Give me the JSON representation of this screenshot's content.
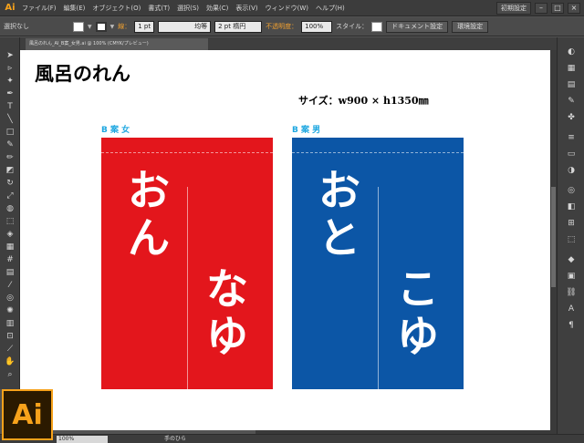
{
  "app": {
    "logo_text": "Ai",
    "badge_text": "Ai"
  },
  "menubar": {
    "items": [
      "ファイル(F)",
      "編集(E)",
      "オブジェクト(O)",
      "書式(T)",
      "選択(S)",
      "効果(C)",
      "表示(V)",
      "ウィンドウ(W)",
      "ヘルプ(H)"
    ],
    "workspace": "初期設定"
  },
  "controlbar": {
    "selection": "選択なし",
    "stroke_label": "線：",
    "stroke_weight": "1 pt",
    "uniform": "均等",
    "brush": "2 pt 楕円",
    "opacity_label": "不透明度：",
    "opacity_value": "100%",
    "style_label": "スタイル：",
    "document_settings": "ドキュメント設定",
    "preferences": "環境設定"
  },
  "document": {
    "tab_name": "風呂のれん_AI_B案_女男.ai @ 100% (CMYK/プレビュー)"
  },
  "artwork": {
    "title": "風呂のれん",
    "size_label": "サイズ：w900 × h1350㎜",
    "plans": [
      {
        "label": "B 案 女",
        "color": "#e3161c",
        "text_upper": "おん",
        "text_lower": "なゆ"
      },
      {
        "label": "B 案 男",
        "color": "#0c56a6",
        "text_upper": "おと",
        "text_lower": "こゆ"
      }
    ]
  },
  "statusbar": {
    "zoom": "100%",
    "tool_name": "手のひら"
  },
  "colors": {
    "accent": "#f7a21b",
    "label_blue": "#1ea7e0"
  }
}
